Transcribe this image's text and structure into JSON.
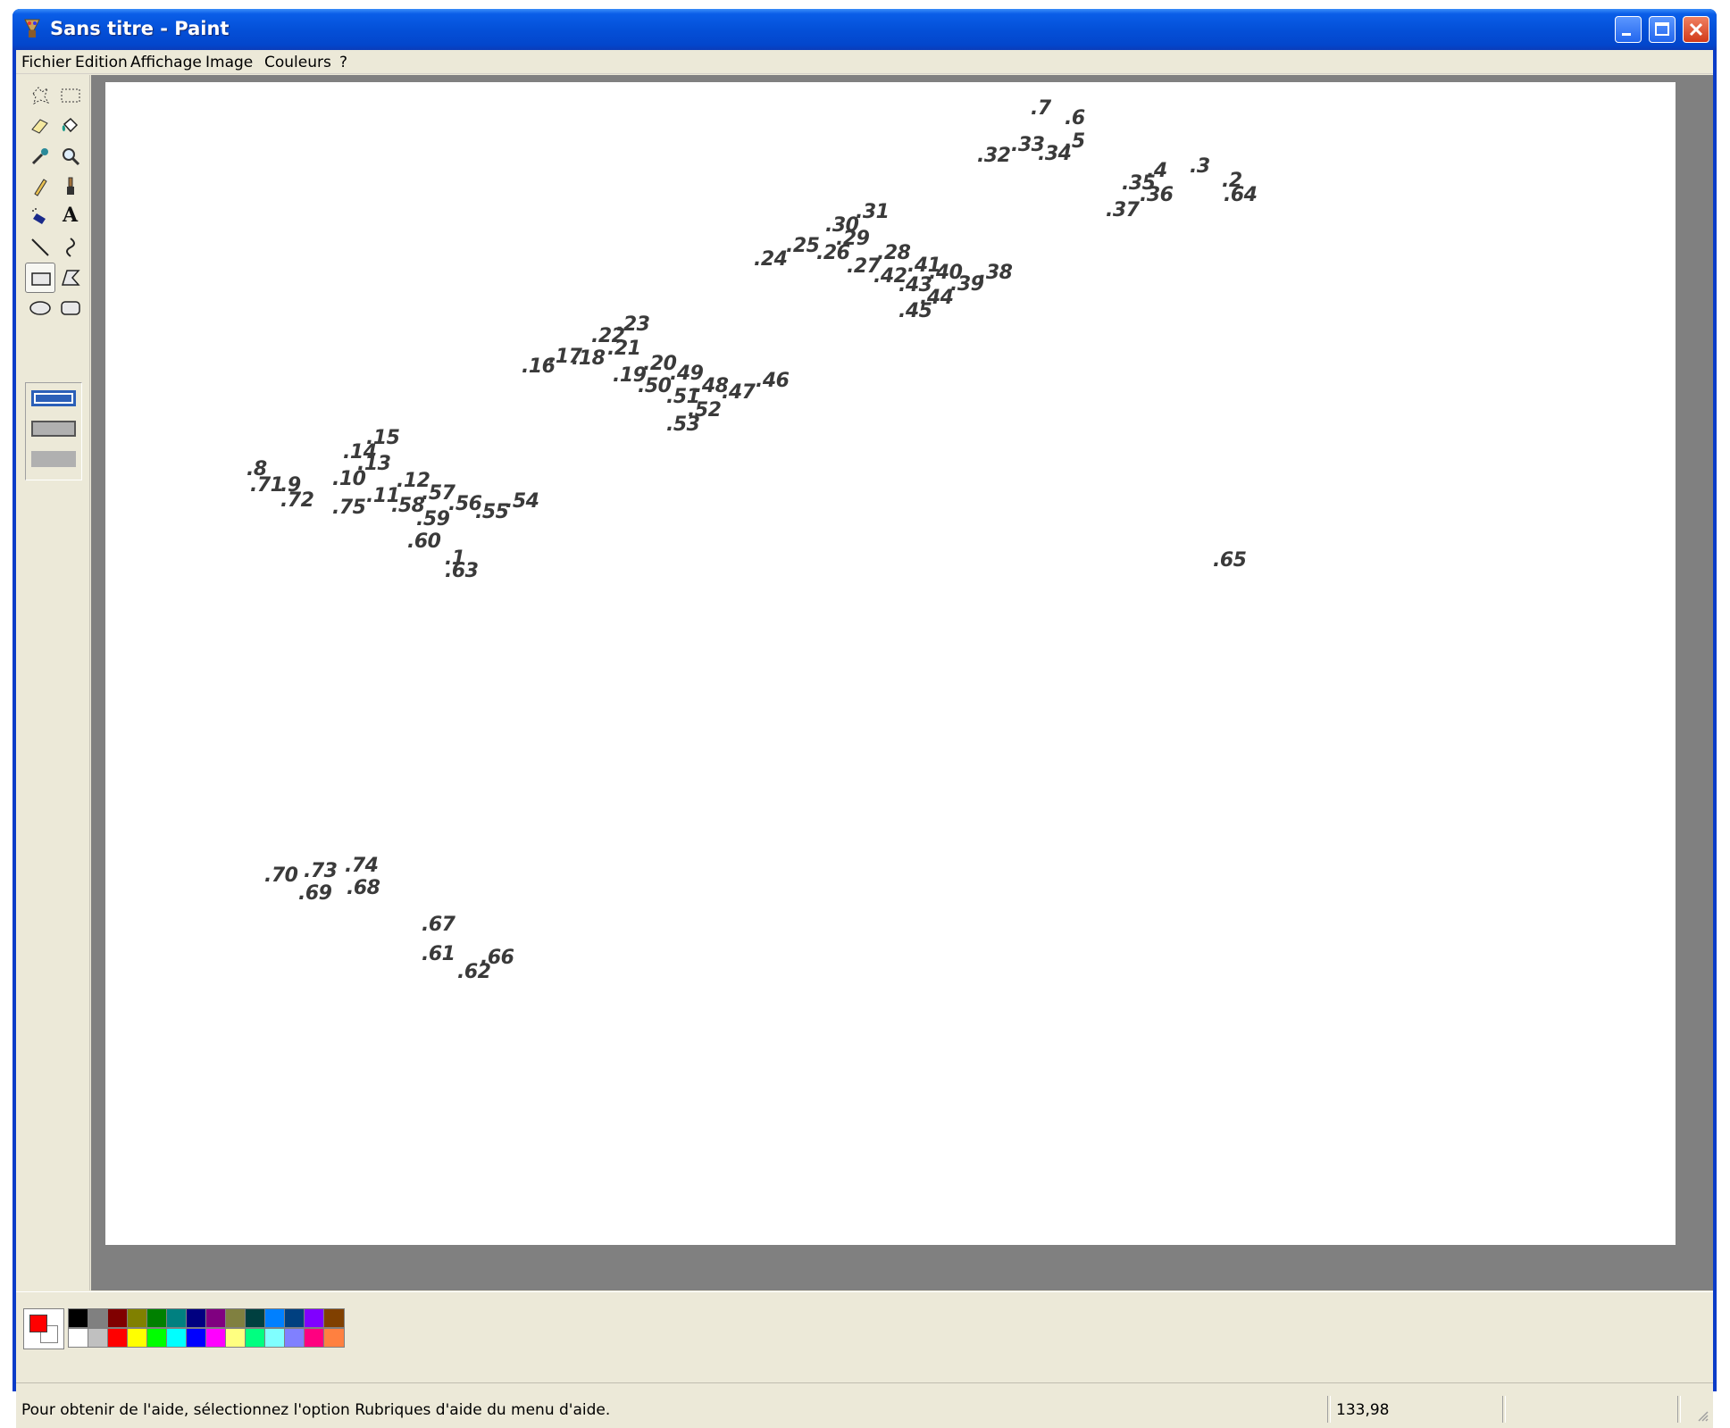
{
  "window": {
    "title": "Sans titre - Paint"
  },
  "menubar": {
    "items": [
      "Fichier",
      "Edition",
      "Affichage",
      "Image",
      "Couleurs",
      "?"
    ]
  },
  "toolbox": {
    "tools": [
      {
        "name": "free-form-select-icon"
      },
      {
        "name": "rect-select-icon"
      },
      {
        "name": "eraser-icon"
      },
      {
        "name": "fill-icon"
      },
      {
        "name": "color-picker-icon"
      },
      {
        "name": "magnifier-icon"
      },
      {
        "name": "pencil-icon"
      },
      {
        "name": "brush-icon"
      },
      {
        "name": "airbrush-icon"
      },
      {
        "name": "text-icon",
        "glyph": "A"
      },
      {
        "name": "line-icon"
      },
      {
        "name": "curve-icon"
      },
      {
        "name": "rectangle-icon",
        "selected": true
      },
      {
        "name": "polygon-icon"
      },
      {
        "name": "ellipse-icon"
      },
      {
        "name": "rounded-rect-icon"
      }
    ],
    "fill_options": [
      "outline",
      "outline-fill",
      "fill"
    ],
    "selected_option": "outline"
  },
  "canvas": {
    "labels": [
      ".7",
      ".6",
      ".32",
      ".33",
      ".34",
      ".5",
      ".4",
      ".3",
      ".35",
      ".36",
      ".2",
      ".64",
      ".37",
      ".31",
      ".30",
      ".29",
      ".25",
      ".26",
      ".24",
      ".28",
      ".27",
      ".41",
      ".42",
      ".40",
      ".43",
      ".39",
      ".38",
      ".44",
      ".45",
      ".23",
      ".22",
      ".21",
      ".16",
      ".17",
      ".18",
      ".20",
      ".19",
      ".49",
      ".50",
      ".48",
      ".51",
      ".47",
      ".46",
      ".52",
      ".53",
      ".15",
      ".14",
      ".13",
      ".8",
      ".10",
      ".71",
      ".9",
      ".12",
      ".57",
      ".72",
      ".11",
      ".56",
      ".54",
      ".75",
      ".58",
      ".55",
      ".59",
      ".60",
      ".1",
      ".63",
      ".65",
      ".74",
      ".70",
      ".73",
      ".69",
      ".68",
      ".67",
      ".61",
      ".66",
      ".62"
    ]
  },
  "palette": {
    "foreground": "#ff0000",
    "background": "#ffffff",
    "top_row": [
      "#000000",
      "#808080",
      "#800000",
      "#808000",
      "#008000",
      "#008080",
      "#000080",
      "#800080",
      "#808040",
      "#004040",
      "#0080ff",
      "#004080",
      "#8000ff",
      "#804000"
    ],
    "bottom_row": [
      "#ffffff",
      "#c0c0c0",
      "#ff0000",
      "#ffff00",
      "#00ff00",
      "#00ffff",
      "#0000ff",
      "#ff00ff",
      "#ffff80",
      "#00ff80",
      "#80ffff",
      "#8080ff",
      "#ff0080",
      "#ff8040"
    ]
  },
  "statusbar": {
    "help_text": "Pour obtenir de l'aide, sélectionnez l'option Rubriques d'aide du menu d'aide.",
    "coords": "133,98"
  }
}
